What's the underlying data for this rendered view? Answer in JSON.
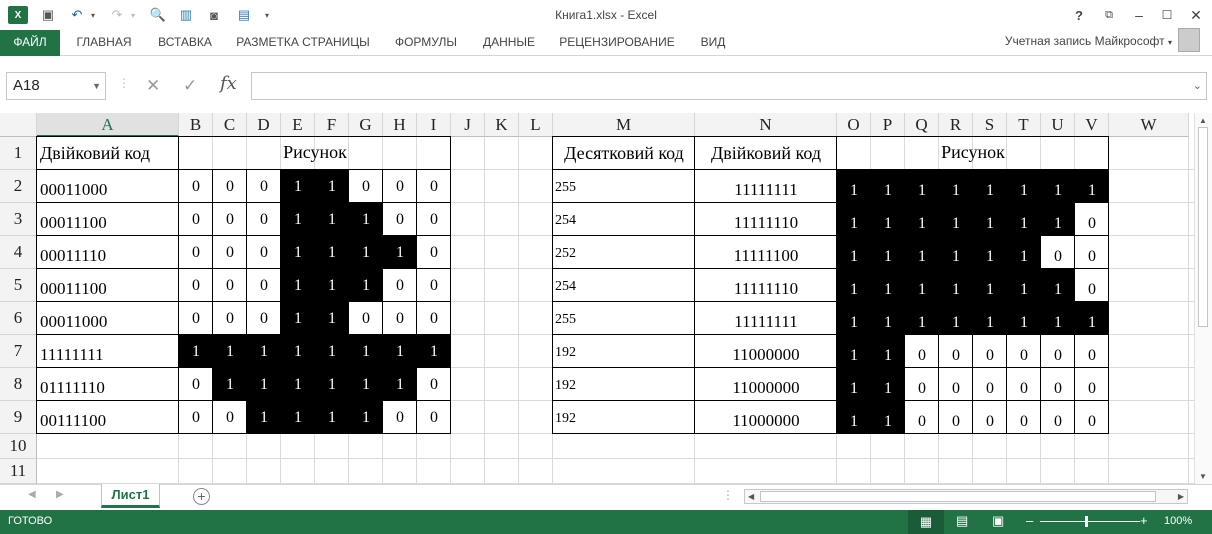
{
  "window": {
    "title": "Книга1.xlsx - Excel"
  },
  "ribbon": {
    "file": "ФАЙЛ",
    "tabs": [
      "ГЛАВНАЯ",
      "ВСТАВКА",
      "РАЗМЕТКА СТРАНИЦЫ",
      "ФОРМУЛЫ",
      "ДАННЫЕ",
      "РЕЦЕНЗИРОВАНИЕ",
      "ВИД"
    ],
    "account": "Учетная запись Майкрософт"
  },
  "formula_bar": {
    "name_box": "A18",
    "fx": "fx",
    "content": ""
  },
  "columns": [
    "A",
    "B",
    "C",
    "D",
    "E",
    "F",
    "G",
    "H",
    "I",
    "J",
    "K",
    "L",
    "M",
    "N",
    "O",
    "P",
    "Q",
    "R",
    "S",
    "T",
    "U",
    "V",
    "W"
  ],
  "rows": [
    "1",
    "2",
    "3",
    "4",
    "5",
    "6",
    "7",
    "8",
    "9",
    "10",
    "11"
  ],
  "left_table": {
    "header_code": "Двійковий код",
    "header_picture": "Рисунок",
    "rows": [
      {
        "code": "00011000",
        "bits": [
          "0",
          "0",
          "0",
          "1",
          "1",
          "0",
          "0",
          "0"
        ]
      },
      {
        "code": "00011100",
        "bits": [
          "0",
          "0",
          "0",
          "1",
          "1",
          "1",
          "0",
          "0"
        ]
      },
      {
        "code": "00011110",
        "bits": [
          "0",
          "0",
          "0",
          "1",
          "1",
          "1",
          "1",
          "0"
        ]
      },
      {
        "code": "00011100",
        "bits": [
          "0",
          "0",
          "0",
          "1",
          "1",
          "1",
          "0",
          "0"
        ]
      },
      {
        "code": "00011000",
        "bits": [
          "0",
          "0",
          "0",
          "1",
          "1",
          "0",
          "0",
          "0"
        ]
      },
      {
        "code": "11111111",
        "bits": [
          "1",
          "1",
          "1",
          "1",
          "1",
          "1",
          "1",
          "1"
        ]
      },
      {
        "code": "01111110",
        "bits": [
          "0",
          "1",
          "1",
          "1",
          "1",
          "1",
          "1",
          "0"
        ]
      },
      {
        "code": "00111100",
        "bits": [
          "0",
          "0",
          "1",
          "1",
          "1",
          "1",
          "0",
          "0"
        ]
      }
    ]
  },
  "right_table": {
    "header_decimal": "Десятковий код",
    "header_binary": "Двійковий код",
    "header_picture": "Рисунок",
    "rows": [
      {
        "dec": "255",
        "bin": "11111111",
        "bits": [
          "1",
          "1",
          "1",
          "1",
          "1",
          "1",
          "1",
          "1"
        ]
      },
      {
        "dec": "254",
        "bin": "11111110",
        "bits": [
          "1",
          "1",
          "1",
          "1",
          "1",
          "1",
          "1",
          "0"
        ]
      },
      {
        "dec": "252",
        "bin": "11111100",
        "bits": [
          "1",
          "1",
          "1",
          "1",
          "1",
          "1",
          "0",
          "0"
        ]
      },
      {
        "dec": "254",
        "bin": "11111110",
        "bits": [
          "1",
          "1",
          "1",
          "1",
          "1",
          "1",
          "1",
          "0"
        ]
      },
      {
        "dec": "255",
        "bin": "11111111",
        "bits": [
          "1",
          "1",
          "1",
          "1",
          "1",
          "1",
          "1",
          "1"
        ]
      },
      {
        "dec": "192",
        "bin": "11000000",
        "bits": [
          "1",
          "1",
          "0",
          "0",
          "0",
          "0",
          "0",
          "0"
        ]
      },
      {
        "dec": "192",
        "bin": "11000000",
        "bits": [
          "1",
          "1",
          "0",
          "0",
          "0",
          "0",
          "0",
          "0"
        ]
      },
      {
        "dec": "192",
        "bin": "11000000",
        "bits": [
          "1",
          "1",
          "0",
          "0",
          "0",
          "0",
          "0",
          "0"
        ]
      }
    ]
  },
  "sheets": {
    "active": "Лист1"
  },
  "status": {
    "ready": "ГОТОВО",
    "zoom": "100%"
  },
  "colors": {
    "accent": "#217346"
  }
}
